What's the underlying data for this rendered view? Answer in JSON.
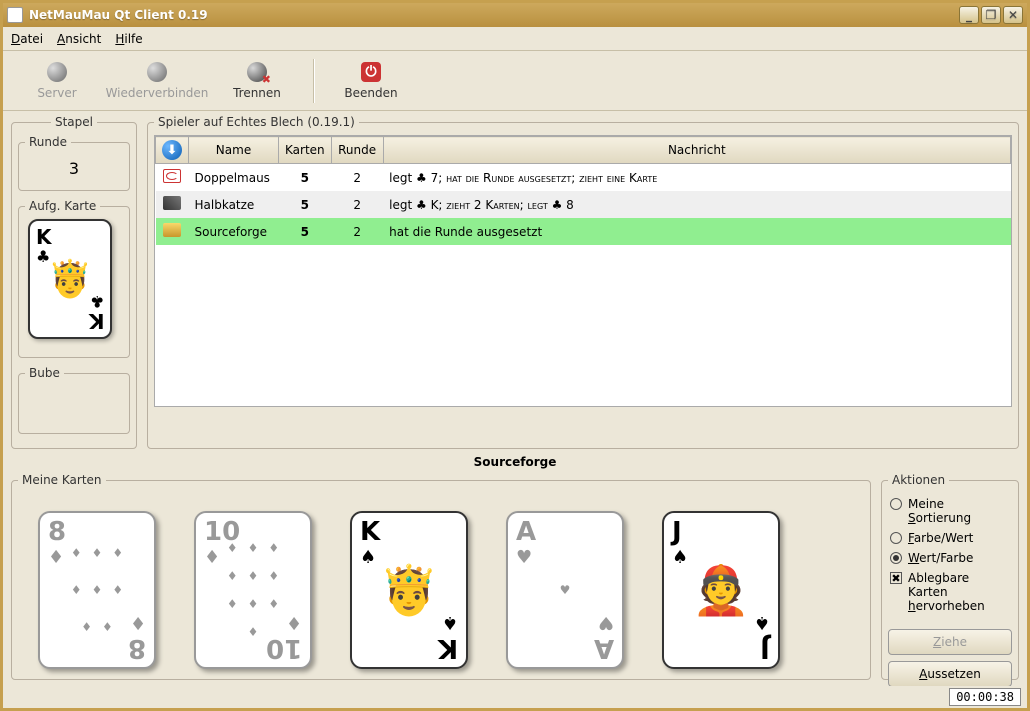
{
  "window": {
    "title": "NetMauMau Qt Client 0.19"
  },
  "menu": {
    "file": "Datei",
    "view": "Ansicht",
    "help": "Hilfe"
  },
  "toolbar": {
    "server": "Server",
    "reconnect": "Wiederverbinden",
    "disconnect": "Trennen",
    "quit": "Beenden"
  },
  "stack": {
    "legend": "Stapel",
    "round_legend": "Runde",
    "round_value": "3",
    "topcard_legend": "Aufg. Karte",
    "jack_legend": "Bube",
    "topcard": {
      "rank": "K",
      "suit": "♣"
    }
  },
  "players": {
    "legend": "Spieler auf Echtes Blech (0.19.1)",
    "columns": {
      "name": "Name",
      "cards": "Karten",
      "round": "Runde",
      "message": "Nachricht"
    },
    "rows": [
      {
        "name": "Doppelmaus",
        "cards": "5",
        "round": "2",
        "msg_pre": "hat die Runde ausgesetzt; zieht eine Karte",
        "card_prefix": "legt ♣ 7; "
      },
      {
        "name": "Halbkatze",
        "cards": "5",
        "round": "2",
        "msg_pre": "zieht 2 Karten; legt ♣ 8",
        "card_prefix": "legt ♣ K; "
      },
      {
        "name": "Sourceforge",
        "cards": "5",
        "round": "2",
        "msg_pre": "",
        "card_prefix": "hat die Runde ausgesetzt"
      }
    ]
  },
  "current_player": "Sourceforge",
  "mycards": {
    "legend": "Meine Karten",
    "cards": [
      {
        "rank": "8",
        "suit": "♦",
        "playable": false,
        "pips": 8
      },
      {
        "rank": "10",
        "suit": "♦",
        "playable": false,
        "pips": 10
      },
      {
        "rank": "K",
        "suit": "♠",
        "playable": true,
        "face": "🤴"
      },
      {
        "rank": "A",
        "suit": "♥",
        "playable": false,
        "pips": 1
      },
      {
        "rank": "J",
        "suit": "♠",
        "playable": true,
        "face": "👲"
      }
    ]
  },
  "actions": {
    "legend": "Aktionen",
    "sort_mine": "Meine Sortierung",
    "sort_suit_rank": "Farbe/Wert",
    "sort_rank_suit": "Wert/Farbe",
    "highlight1": "Ablegbare Karten",
    "highlight2": "hervorheben",
    "draw": "Ziehe",
    "pass": "Aussetzen"
  },
  "status": {
    "timer": "00:00:38"
  }
}
